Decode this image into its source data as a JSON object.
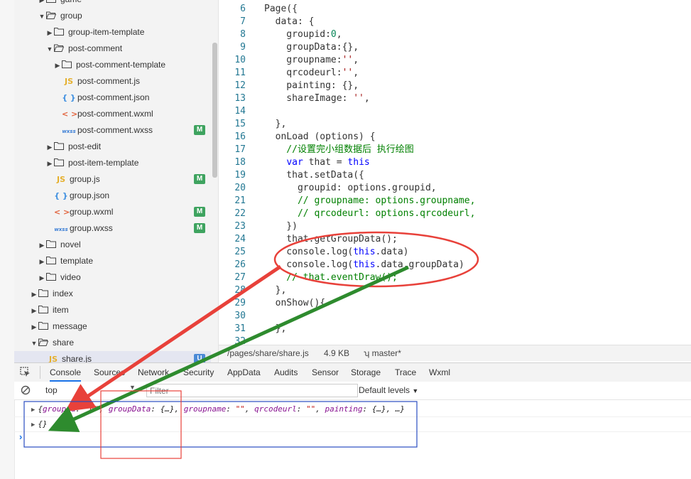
{
  "file_tree": [
    {
      "label": "game",
      "kind": "folder",
      "depth": 1,
      "open": false
    },
    {
      "label": "group",
      "kind": "folder",
      "depth": 1,
      "open": true
    },
    {
      "label": "group-item-template",
      "kind": "folder",
      "depth": 2,
      "open": false
    },
    {
      "label": "post-comment",
      "kind": "folder",
      "depth": 2,
      "open": true
    },
    {
      "label": "post-comment-template",
      "kind": "folder",
      "depth": 3,
      "open": false
    },
    {
      "label": "post-comment.js",
      "kind": "js",
      "depth": 3,
      "icon": "JS",
      "badge": ""
    },
    {
      "label": "post-comment.json",
      "kind": "json",
      "depth": 3,
      "icon": "{ }",
      "badge": ""
    },
    {
      "label": "post-comment.wxml",
      "kind": "wxml",
      "depth": 3,
      "icon": "< >",
      "badge": ""
    },
    {
      "label": "post-comment.wxss",
      "kind": "wxss",
      "depth": 3,
      "icon": "wxss",
      "badge": "M"
    },
    {
      "label": "post-edit",
      "kind": "folder",
      "depth": 2,
      "open": false
    },
    {
      "label": "post-item-template",
      "kind": "folder",
      "depth": 2,
      "open": false
    },
    {
      "label": "group.js",
      "kind": "js",
      "depth": 2,
      "icon": "JS",
      "badge": "M"
    },
    {
      "label": "group.json",
      "kind": "json",
      "depth": 2,
      "icon": "{ }",
      "badge": ""
    },
    {
      "label": "group.wxml",
      "kind": "wxml",
      "depth": 2,
      "icon": "< >",
      "badge": "M"
    },
    {
      "label": "group.wxss",
      "kind": "wxss",
      "depth": 2,
      "icon": "wxss",
      "badge": "M"
    },
    {
      "label": "novel",
      "kind": "folder",
      "depth": 1,
      "open": false
    },
    {
      "label": "template",
      "kind": "folder",
      "depth": 1,
      "open": false
    },
    {
      "label": "video",
      "kind": "folder",
      "depth": 1,
      "open": false
    },
    {
      "label": "index",
      "kind": "folder",
      "depth": 0,
      "open": false
    },
    {
      "label": "item",
      "kind": "folder",
      "depth": 0,
      "open": false
    },
    {
      "label": "message",
      "kind": "folder",
      "depth": 0,
      "open": false
    },
    {
      "label": "share",
      "kind": "folder",
      "depth": 0,
      "open": true
    },
    {
      "label": "share.js",
      "kind": "js",
      "depth": 1,
      "icon": "JS",
      "badge": "U",
      "active": true
    }
  ],
  "code_lines": [
    {
      "n": "6",
      "segs": [
        [
          "Page({",
          ""
        ]
      ]
    },
    {
      "n": "7",
      "segs": [
        [
          "  data: {",
          ""
        ]
      ]
    },
    {
      "n": "8",
      "segs": [
        [
          "    groupid:",
          ""
        ],
        [
          "0",
          "c-num"
        ],
        [
          ",",
          ""
        ]
      ]
    },
    {
      "n": "9",
      "segs": [
        [
          "    groupData:{},",
          ""
        ]
      ]
    },
    {
      "n": "10",
      "segs": [
        [
          "    groupname:",
          ""
        ],
        [
          "''",
          "c-red"
        ],
        [
          ",",
          ""
        ]
      ]
    },
    {
      "n": "11",
      "segs": [
        [
          "    qrcodeurl:",
          ""
        ],
        [
          "''",
          "c-red"
        ],
        [
          ",",
          ""
        ]
      ]
    },
    {
      "n": "12",
      "segs": [
        [
          "    painting: {},",
          ""
        ]
      ]
    },
    {
      "n": "13",
      "segs": [
        [
          "    shareImage: ",
          ""
        ],
        [
          "''",
          "c-red"
        ],
        [
          ",",
          ""
        ]
      ]
    },
    {
      "n": "14",
      "segs": [
        [
          "",
          ""
        ]
      ]
    },
    {
      "n": "15",
      "segs": [
        [
          "  },",
          ""
        ]
      ]
    },
    {
      "n": "16",
      "segs": [
        [
          "  onLoad (options) {",
          ""
        ]
      ]
    },
    {
      "n": "17",
      "segs": [
        [
          "    //设置完小组数据后 执行绘图",
          "c-green"
        ]
      ]
    },
    {
      "n": "18",
      "segs": [
        [
          "    ",
          ""
        ],
        [
          "var",
          "c-blue"
        ],
        [
          " that = ",
          ""
        ],
        [
          "this",
          "c-blue"
        ]
      ]
    },
    {
      "n": "19",
      "segs": [
        [
          "    that.setData({",
          ""
        ]
      ]
    },
    {
      "n": "20",
      "segs": [
        [
          "      groupid: options.groupid,",
          ""
        ]
      ]
    },
    {
      "n": "21",
      "segs": [
        [
          "      // groupname: options.groupname,",
          "c-green"
        ]
      ]
    },
    {
      "n": "22",
      "segs": [
        [
          "      // qrcodeurl: options.qrcodeurl,",
          "c-green"
        ]
      ]
    },
    {
      "n": "23",
      "segs": [
        [
          "    })",
          ""
        ]
      ]
    },
    {
      "n": "24",
      "segs": [
        [
          "    that.getGroupData();",
          ""
        ]
      ]
    },
    {
      "n": "25",
      "segs": [
        [
          "    console.log(",
          ""
        ],
        [
          "this",
          "c-blue"
        ],
        [
          ".data)",
          ""
        ]
      ]
    },
    {
      "n": "26",
      "segs": [
        [
          "    console.log(",
          ""
        ],
        [
          "this",
          "c-blue"
        ],
        [
          ".data.groupData)",
          ""
        ]
      ]
    },
    {
      "n": "27",
      "segs": [
        [
          "    // that.eventDraw();",
          "c-green"
        ]
      ]
    },
    {
      "n": "28",
      "segs": [
        [
          "  },",
          ""
        ]
      ]
    },
    {
      "n": "29",
      "segs": [
        [
          "  onShow(){",
          ""
        ]
      ]
    },
    {
      "n": "30",
      "segs": [
        [
          "",
          ""
        ]
      ]
    },
    {
      "n": "31",
      "segs": [
        [
          "  },",
          ""
        ]
      ]
    },
    {
      "n": "32",
      "segs": [
        [
          "",
          ""
        ]
      ]
    }
  ],
  "statusbar": {
    "path": "/pages/share/share.js",
    "size": "4.9 KB",
    "branch": "master*"
  },
  "devtools": {
    "tabs": [
      "Console",
      "Sources",
      "Network",
      "Security",
      "AppData",
      "Audits",
      "Sensor",
      "Storage",
      "Trace",
      "Wxml"
    ],
    "active_tab": "Console",
    "context": "top",
    "filter_placeholder": "Filter",
    "levels": "Default levels"
  },
  "console": {
    "line1_parts": [
      [
        "{",
        ""
      ],
      [
        "groupid",
        "k"
      ],
      [
        ": ",
        ""
      ],
      [
        "\"6\"",
        "s"
      ],
      [
        ", ",
        ""
      ],
      [
        "groupData",
        "k"
      ],
      [
        ": {…}, ",
        ""
      ],
      [
        "groupname",
        "k"
      ],
      [
        ": ",
        ""
      ],
      [
        "\"\"",
        "s"
      ],
      [
        ", ",
        ""
      ],
      [
        "qrcodeurl",
        "k"
      ],
      [
        ": ",
        ""
      ],
      [
        "\"\"",
        "s"
      ],
      [
        ", ",
        ""
      ],
      [
        "painting",
        "k"
      ],
      [
        ": {…}, …}",
        ""
      ]
    ],
    "line2": "{}",
    "prompt": "›"
  },
  "colors": {
    "annotation_red": "#e8413a",
    "annotation_green": "#2e8b2e",
    "annotation_blue": "#2a4cc0",
    "badge_modified": "#3ea35f",
    "badge_untracked": "#4b8ad6"
  }
}
